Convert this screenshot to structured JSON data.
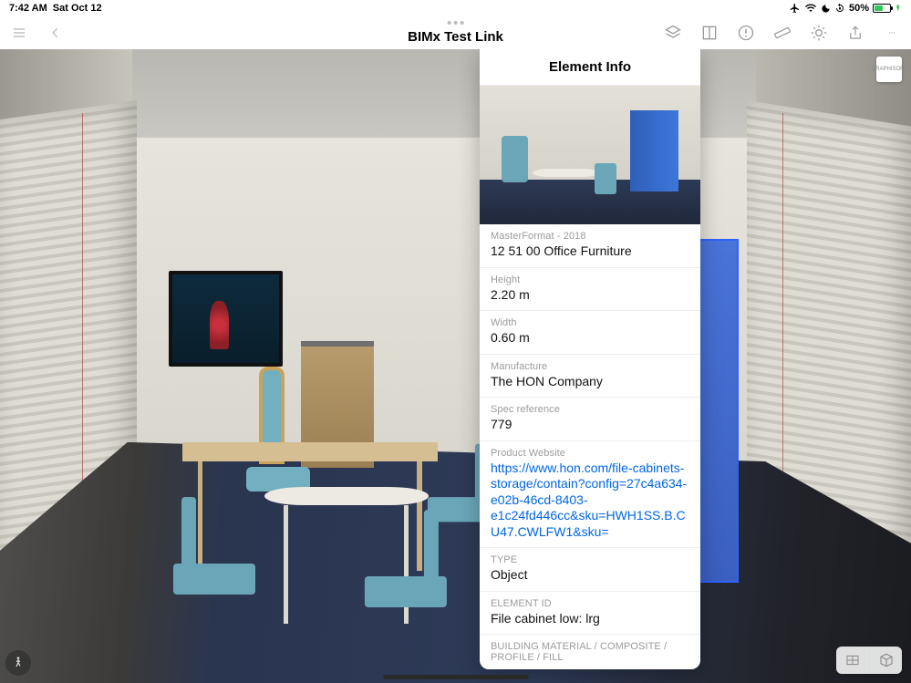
{
  "status_bar": {
    "time": "7:42 AM",
    "date": "Sat Oct 12",
    "battery_pct": "50%"
  },
  "toolbar": {
    "title": "BIMx Test Link"
  },
  "popover": {
    "title": "Element Info",
    "fields": [
      {
        "label": "MasterFormat - 2018",
        "value": "12 51 00 Office Furniture",
        "link": false
      },
      {
        "label": "Height",
        "value": "2.20 m",
        "link": false
      },
      {
        "label": "Width",
        "value": "0.60 m",
        "link": false
      },
      {
        "label": "Manufacture",
        "value": "The HON Company",
        "link": false
      },
      {
        "label": "Spec reference",
        "value": "779",
        "link": false
      },
      {
        "label": "Product Website",
        "value": "https://www.hon.com/file-cabinets-storage/contain?config=27c4a634-e02b-46cd-8403-e1c24fd446cc&sku=HWH1SS.B.CU47.CWLFW1&sku=",
        "link": true
      },
      {
        "label": "TYPE",
        "value": "Object",
        "link": false
      },
      {
        "label": "ELEMENT ID",
        "value": "File cabinet low: lrg",
        "link": false
      },
      {
        "label": "BUILDING MATERIAL / COMPOSITE / PROFILE / FILL",
        "value": "",
        "link": false
      }
    ]
  },
  "logo_text": "GRAPHISOFT"
}
